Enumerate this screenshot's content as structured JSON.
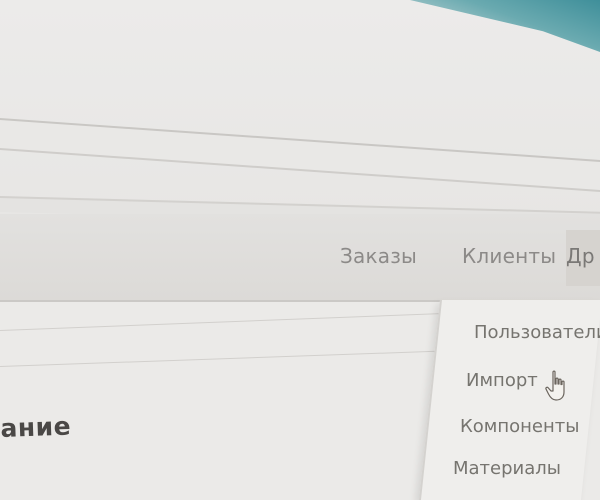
{
  "nav": {
    "items": [
      {
        "label": "Заказы"
      },
      {
        "label": "Клиенты"
      },
      {
        "label": "Др"
      }
    ]
  },
  "dropdown": {
    "items": [
      {
        "label": "Пользователи"
      },
      {
        "label": "Импорт"
      },
      {
        "label": "Компоненты"
      },
      {
        "label": "Материалы"
      }
    ]
  },
  "page": {
    "heading": "ание"
  },
  "icons": {
    "cursor": "hand-pointer-icon"
  },
  "colors": {
    "accent": "#3f8f9a",
    "nav_text": "#8c8a88",
    "heading_text": "#4a4846"
  }
}
